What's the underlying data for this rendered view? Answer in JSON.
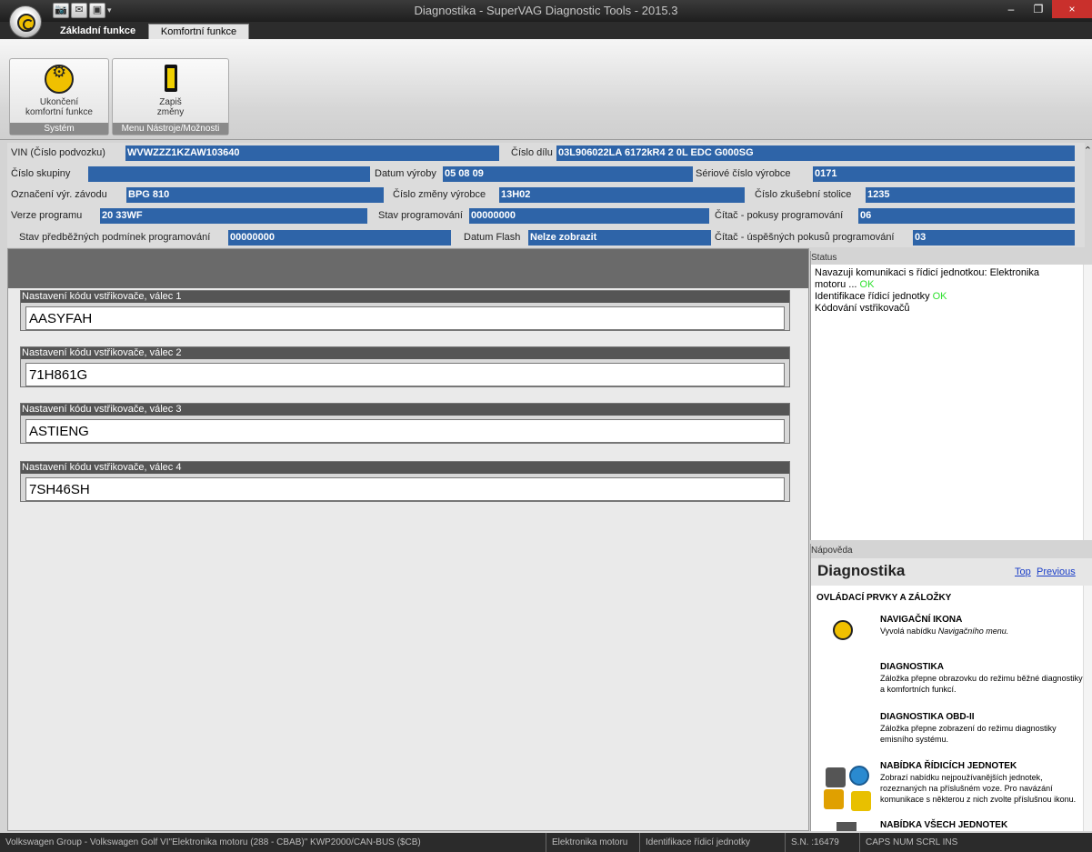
{
  "window": {
    "title": "Diagnostika - SuperVAG Diagnostic Tools - 2015.3",
    "minimize": "–",
    "maximize": "❐",
    "close": "×"
  },
  "quick_access": [
    "📷",
    "✉",
    "▣"
  ],
  "tabs": [
    {
      "label": "Základní funkce"
    },
    {
      "label": "Komfortní funkce"
    }
  ],
  "ribbon": {
    "buttons": [
      {
        "label_line1": "Ukončení",
        "label_line2": "komfortní funkce"
      },
      {
        "label_line1": "Zapiš",
        "label_line2": "změny"
      }
    ],
    "groups": [
      "Systém",
      "Menu Nástroje/Možnosti"
    ]
  },
  "info": {
    "vin_label": "VIN (Číslo podvozku)",
    "vin_value": "WVWZZZ1KZAW103640",
    "part_label": "Číslo dílu",
    "part_value": "03L906022LA 6172kR4 2 0L EDC G000SG",
    "group_label": "Číslo skupiny",
    "group_value": "",
    "mfg_date_label": "Datum výroby",
    "mfg_date_value": "05 08 09",
    "serial_label": "Sériové číslo výrobce",
    "serial_value": "0171",
    "plant_label": "Označení výr. závodu",
    "plant_value": "BPG 810",
    "change_label": "Číslo změny výrobce",
    "change_value": "13H02",
    "bench_label": "Číslo zkušební stolice",
    "bench_value": "1235",
    "prog_ver_label": "Verze programu",
    "prog_ver_value": "20    33WF",
    "prog_state_label": "Stav programování",
    "prog_state_value": "00000000",
    "attempts_label": "Čítač - pokusy programování",
    "attempts_value": "06",
    "precond_label": "Stav předběžných podmínek programování",
    "precond_value": "00000000",
    "flash_label": "Datum Flash",
    "flash_value": "Nelze zobrazit",
    "success_label": "Čítač - úspěšných pokusů programování",
    "success_value": "03",
    "collapse": "⌃"
  },
  "injectors": [
    {
      "label": "Nastavení kódu vstřikovače, válec 1",
      "value": "AASYFAH"
    },
    {
      "label": "Nastavení kódu vstřikovače, válec 2",
      "value": "71H861G"
    },
    {
      "label": "Nastavení kódu vstřikovače, válec 3",
      "value": "ASTIENG"
    },
    {
      "label": "Nastavení kódu vstřikovače, válec 4",
      "value": "7SH46SH"
    }
  ],
  "status": {
    "header": "Status",
    "line1": "Navazuji komunikaci s řídicí jednotkou: Elektronika",
    "line2": "motoru ... ",
    "line2_ok": "OK",
    "line3": "Identifikace řídicí jednotky ",
    "line3_ok": "OK",
    "line4": "Kódování vstřikovačů"
  },
  "help": {
    "header": "Nápověda",
    "title": "Diagnostika",
    "top_link": "Top",
    "prev_link": "Previous",
    "section": "OVLÁDACÍ PRVKY A ZÁLOŽKY",
    "items": [
      {
        "title": "NAVIGAČNÍ IKONA",
        "text": "Vyvolá nabídku ",
        "text_em": "Navigačního menu."
      },
      {
        "title": "DIAGNOSTIKA",
        "text": "Záložka přepne obrazovku do režimu běžné diagnostiky a komfortních funkcí."
      },
      {
        "title": "DIAGNOSTIKA OBD-II",
        "text": "Záložka přepne zobrazení do režimu diagnostiky emisního systému."
      },
      {
        "title": "NABÍDKA ŘÍDICÍCH JEDNOTEK",
        "text": "Zobrazí nabídku nejpoužívanějších jednotek, rozeznaných na příslušném voze. Pro navázání komunikace s některou z nich zvolte příslušnou ikonu."
      },
      {
        "title": "NABÍDKA VŠECH JEDNOTEK",
        "text": ""
      }
    ]
  },
  "statusbar": {
    "vehicle": "Volkswagen Group - Volkswagen Golf VI\"Elektronika motoru (288 - CBAB)\" KWP2000/CAN-BUS ($CB)",
    "module": "Elektronika motoru",
    "action": "Identifikace řídicí jednotky",
    "serial": "S.N. :16479",
    "keys": "CAPS  NUM  SCRL  INS"
  }
}
